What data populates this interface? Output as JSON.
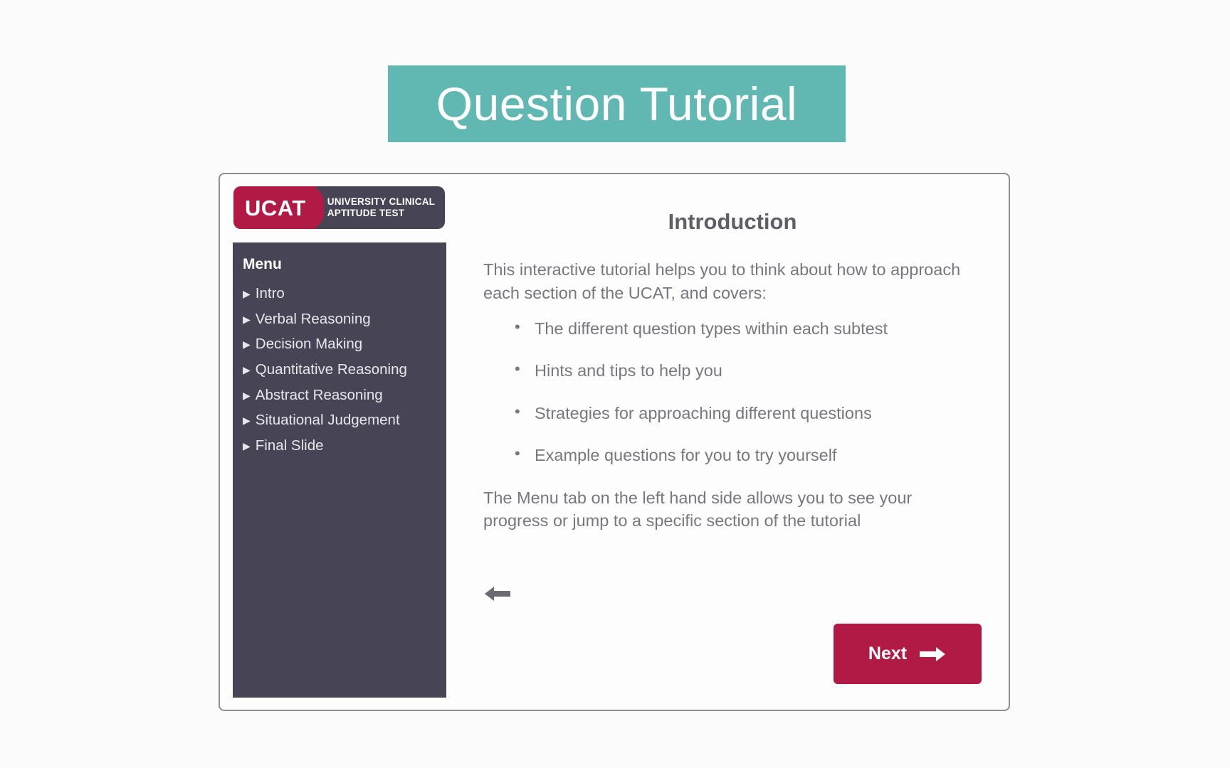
{
  "banner": {
    "title": "Question Tutorial",
    "background_color": "#61b8b2",
    "text_color": "#ffffff"
  },
  "logo": {
    "mark_text": "UCAT",
    "panel_line_1": "UNIVERSITY CLINICAL",
    "panel_line_2": "APTITUDE TEST",
    "mark_color": "#b01a44",
    "panel_color": "#474455"
  },
  "sidebar": {
    "title": "Menu",
    "background_color": "#474455",
    "items": [
      {
        "label": "Intro",
        "icon": "triangle-right-icon"
      },
      {
        "label": "Verbal Reasoning",
        "icon": "triangle-right-icon"
      },
      {
        "label": "Decision Making",
        "icon": "triangle-right-icon"
      },
      {
        "label": "Quantitative Reasoning",
        "icon": "triangle-right-icon"
      },
      {
        "label": "Abstract Reasoning",
        "icon": "triangle-right-icon"
      },
      {
        "label": "Situational Judgement",
        "icon": "triangle-right-icon"
      },
      {
        "label": "Final Slide",
        "icon": "triangle-right-icon"
      }
    ]
  },
  "main": {
    "heading": "Introduction",
    "intro_paragraph": "This interactive tutorial helps you to think about how to approach each section of the UCAT, and covers:",
    "bullets": [
      "The different question types within each subtest",
      "Hints and tips to help you",
      "Strategies for approaching different questions",
      "Example questions for you to try yourself"
    ],
    "closing_paragraph": "The Menu tab on the left hand side allows you to see your progress or jump to a specific section of the tutorial"
  },
  "navigation": {
    "back_icon": "arrow-left-icon",
    "next_label": "Next",
    "next_icon": "arrow-right-icon",
    "next_color": "#b01a44"
  }
}
